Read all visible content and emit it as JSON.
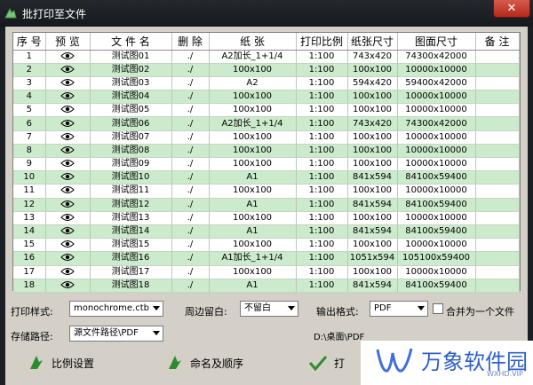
{
  "window": {
    "title": "批打印至文件",
    "close_label": "✕"
  },
  "table": {
    "columns": [
      "序 号",
      "预 览",
      "文 件 名",
      "删 除",
      "纸 张",
      "打印比例",
      "纸张尺寸",
      "图面尺寸",
      "备 注"
    ],
    "rows": [
      {
        "no": "1",
        "name": "测试图01",
        "del": "./",
        "paper": "A2加长_1+1/4",
        "scale": "1:100",
        "paper_size": "743x420",
        "drawing_size": "74300x42000",
        "note": ""
      },
      {
        "no": "2",
        "name": "测试图02",
        "del": "./",
        "paper": "100x100",
        "scale": "1:100",
        "paper_size": "100x100",
        "drawing_size": "10000x10000",
        "note": ""
      },
      {
        "no": "3",
        "name": "测试图03",
        "del": "./",
        "paper": "A2",
        "scale": "1:100",
        "paper_size": "594x420",
        "drawing_size": "59400x42000",
        "note": ""
      },
      {
        "no": "4",
        "name": "测试图04",
        "del": "./",
        "paper": "100x100",
        "scale": "1:100",
        "paper_size": "100x100",
        "drawing_size": "10000x10000",
        "note": ""
      },
      {
        "no": "5",
        "name": "测试图05",
        "del": "./",
        "paper": "100x100",
        "scale": "1:100",
        "paper_size": "100x100",
        "drawing_size": "10000x10000",
        "note": ""
      },
      {
        "no": "6",
        "name": "测试图06",
        "del": "./",
        "paper": "A2加长_1+1/4",
        "scale": "1:100",
        "paper_size": "743x420",
        "drawing_size": "74300x42000",
        "note": ""
      },
      {
        "no": "7",
        "name": "测试图07",
        "del": "./",
        "paper": "100x100",
        "scale": "1:100",
        "paper_size": "100x100",
        "drawing_size": "10000x10000",
        "note": ""
      },
      {
        "no": "8",
        "name": "测试图08",
        "del": "./",
        "paper": "100x100",
        "scale": "1:100",
        "paper_size": "100x100",
        "drawing_size": "10000x10000",
        "note": ""
      },
      {
        "no": "9",
        "name": "测试图09",
        "del": "./",
        "paper": "100x100",
        "scale": "1:100",
        "paper_size": "100x100",
        "drawing_size": "10000x10000",
        "note": ""
      },
      {
        "no": "10",
        "name": "测试图10",
        "del": "./",
        "paper": "A1",
        "scale": "1:100",
        "paper_size": "841x594",
        "drawing_size": "84100x59400",
        "note": ""
      },
      {
        "no": "11",
        "name": "测试图11",
        "del": "./",
        "paper": "100x100",
        "scale": "1:100",
        "paper_size": "100x100",
        "drawing_size": "10000x10000",
        "note": ""
      },
      {
        "no": "12",
        "name": "测试图12",
        "del": "./",
        "paper": "A1",
        "scale": "1:100",
        "paper_size": "841x594",
        "drawing_size": "84100x59400",
        "note": ""
      },
      {
        "no": "13",
        "name": "测试图13",
        "del": "./",
        "paper": "100x100",
        "scale": "1:100",
        "paper_size": "100x100",
        "drawing_size": "10000x10000",
        "note": ""
      },
      {
        "no": "14",
        "name": "测试图14",
        "del": "./",
        "paper": "A1",
        "scale": "1:100",
        "paper_size": "841x594",
        "drawing_size": "84100x59400",
        "note": ""
      },
      {
        "no": "15",
        "name": "测试图15",
        "del": "./",
        "paper": "100x100",
        "scale": "1:100",
        "paper_size": "100x100",
        "drawing_size": "10000x10000",
        "note": ""
      },
      {
        "no": "16",
        "name": "测试图16",
        "del": "./",
        "paper": "A1加长_1+1/4",
        "scale": "1:100",
        "paper_size": "1051x594",
        "drawing_size": "105100x59400",
        "note": ""
      },
      {
        "no": "17",
        "name": "测试图17",
        "del": "./",
        "paper": "100x100",
        "scale": "1:100",
        "paper_size": "100x100",
        "drawing_size": "10000x10000",
        "note": ""
      },
      {
        "no": "18",
        "name": "测试图18",
        "del": "./",
        "paper": "A1",
        "scale": "1:100",
        "paper_size": "841x594",
        "drawing_size": "84100x59400",
        "note": ""
      }
    ]
  },
  "options": {
    "print_style_label": "打印样式:",
    "print_style_value": "monochrome.ctb",
    "margin_label": "周边留白:",
    "margin_value": "不留白",
    "output_format_label": "输出格式:",
    "output_format_value": "PDF",
    "merge_label": "合并为一个文件",
    "merge_checked": false,
    "save_path_label": "存储路径:",
    "save_path_value": "源文件路径\\PDF",
    "save_path_display": "D:\\桌面\\PDF"
  },
  "buttons": {
    "scale_settings": "比例设置",
    "naming_order": "命名及顺序",
    "print": "打"
  },
  "watermark": {
    "brand": "万象软件园",
    "sub": "WXHD.VIP"
  },
  "colors": {
    "row_even": "#ccebcc",
    "row_odd": "#ffffff",
    "accent_green": "#2e8b2e"
  }
}
